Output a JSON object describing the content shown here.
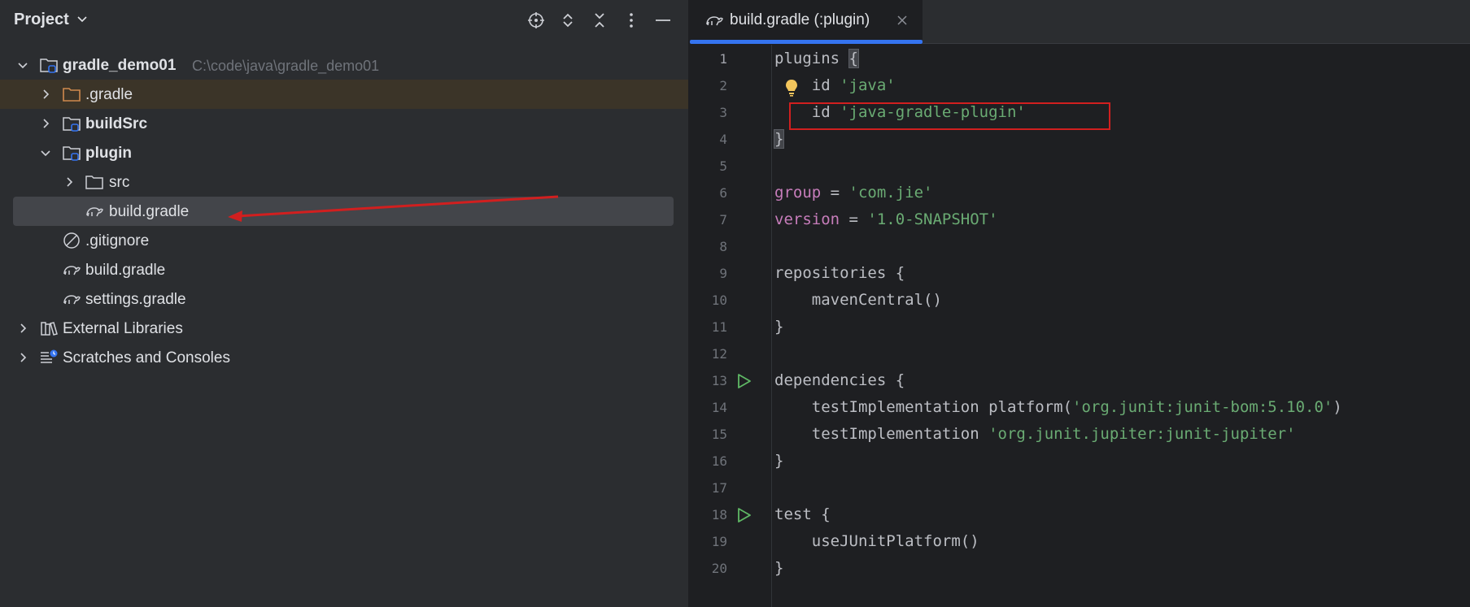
{
  "project_panel": {
    "title": "Project",
    "tree": [
      {
        "label": "gradle_demo01",
        "path": "C:\\code\\java\\gradle_demo01",
        "bold": true,
        "expanded": true
      },
      {
        "label": ".gradle",
        "bold": false,
        "expanded": false,
        "highlighted": true
      },
      {
        "label": "buildSrc",
        "bold": true,
        "expanded": false
      },
      {
        "label": "plugin",
        "bold": true,
        "expanded": true
      },
      {
        "label": "src",
        "bold": false,
        "expanded": false
      },
      {
        "label": "build.gradle",
        "bold": false,
        "selected": true
      },
      {
        "label": ".gitignore",
        "bold": false
      },
      {
        "label": "build.gradle",
        "bold": false
      },
      {
        "label": "settings.gradle",
        "bold": false
      },
      {
        "label": "External Libraries",
        "bold": false,
        "expanded": false
      },
      {
        "label": "Scratches and Consoles",
        "bold": false,
        "expanded": false
      }
    ]
  },
  "editor": {
    "tab_label": "build.gradle (:plugin)",
    "line_numbers": [
      "1",
      "2",
      "3",
      "4",
      "5",
      "6",
      "7",
      "8",
      "9",
      "10",
      "11",
      "12",
      "13",
      "14",
      "15",
      "16",
      "17",
      "18",
      "19",
      "20"
    ],
    "code": {
      "l1": "plugins ",
      "l1_brace": "{",
      "l2_kw": "id ",
      "l2_str": "'java'",
      "l3_kw": "id ",
      "l3_str": "'java-gradle-plugin'",
      "l4_brace": "}",
      "l6_prop": "group",
      "l6_eq": " = ",
      "l6_str": "'com.jie'",
      "l7_prop": "version",
      "l7_eq": " = ",
      "l7_str": "'1.0-SNAPSHOT'",
      "l9": "repositories {",
      "l10": "    mavenCentral()",
      "l11": "}",
      "l13": "dependencies {",
      "l14_a": "    testImplementation platform(",
      "l14_str": "'org.junit:junit-bom:5.10.0'",
      "l14_b": ")",
      "l15_a": "    testImplementation ",
      "l15_str": "'org.junit.jupiter:junit-jupiter'",
      "l16": "}",
      "l18": "test {",
      "l19": "    useJUnitPlatform()",
      "l20": "}"
    }
  },
  "colors": {
    "panel_bg": "#2b2d30",
    "editor_bg": "#1e1f22",
    "accent": "#3574f0",
    "string": "#6aab73",
    "property": "#c77dbb",
    "annotation": "#d11f1f",
    "folder_orange": "#d08a4e",
    "module_blue": "#3574f0"
  }
}
